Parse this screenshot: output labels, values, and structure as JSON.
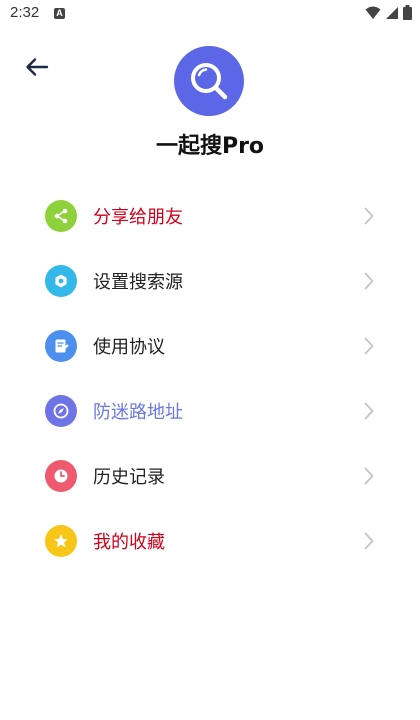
{
  "status_bar": {
    "time": "2:32",
    "notification_badge": "A"
  },
  "header": {
    "back_icon": "arrow-left-icon",
    "logo_icon": "magnifier-icon"
  },
  "app": {
    "title": "一起搜Pro"
  },
  "colors": {
    "logo_bg": "#5b67e6",
    "label_default": "#222222",
    "label_red": "#d0021b",
    "label_blue": "#6b78e0",
    "chevron": "#c4c4c4"
  },
  "menu": {
    "items": [
      {
        "label": "分享给朋友",
        "icon": "share-icon",
        "icon_color": "#8ed13a",
        "label_color": "#d0021b"
      },
      {
        "label": "设置搜索源",
        "icon": "gear-icon",
        "icon_color": "#33b8ea",
        "label_color": "#222222"
      },
      {
        "label": "使用协议",
        "icon": "document-edit-icon",
        "icon_color": "#4d8fef",
        "label_color": "#222222"
      },
      {
        "label": "防迷路地址",
        "icon": "compass-icon",
        "icon_color": "#6e74e6",
        "label_color": "#6b78e0"
      },
      {
        "label": "历史记录",
        "icon": "clock-icon",
        "icon_color": "#ef5a6f",
        "label_color": "#222222"
      },
      {
        "label": "我的收藏",
        "icon": "star-icon",
        "icon_color": "#f8c619",
        "label_color": "#d0021b"
      }
    ]
  }
}
